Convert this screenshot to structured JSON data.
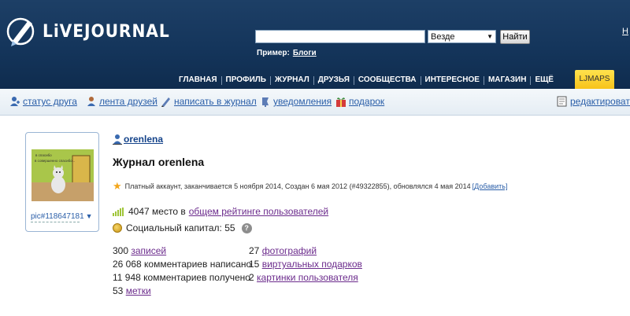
{
  "header": {
    "logo_text": "LiVEJOURNAL",
    "search": {
      "value": "",
      "scope": "Везде",
      "button": "Найти"
    },
    "example_label": "Пример:",
    "example_link": "Блоги",
    "top_right_link": "Н",
    "nav": [
      "ГЛАВНАЯ",
      "ПРОФИЛЬ",
      "ЖУРНАЛ",
      "ДРУЗЬЯ",
      "СООБЩЕСТВА",
      "ИНТЕРЕСНОЕ",
      "МАГАЗИН",
      "ЕЩЁ"
    ],
    "ljmaps": "LJMAPS"
  },
  "userbar": {
    "items": [
      {
        "label": "статус друга",
        "icon": "friend-status-icon"
      },
      {
        "label": "лента друзей",
        "icon": "friends-feed-icon"
      },
      {
        "label": "написать в журнал",
        "icon": "write-post-icon"
      },
      {
        "label": "уведомления",
        "icon": "notifications-icon"
      },
      {
        "label": "подарок",
        "icon": "gift-icon"
      },
      {
        "label": "редактировать",
        "icon": "edit-icon"
      }
    ]
  },
  "profile": {
    "userpic_label": "pic#118647181",
    "userpic_caption": "в спасибо\nв совершенно спасибо...",
    "username": "orenlena",
    "journal_title": "Журнал orenlena",
    "account_text": "Платный аккаунт, заканчивается 5 ноября 2014, Создан 6 мая 2012 (#49322855),  обновлялся 4 мая 2014",
    "account_link": "[Добавить]",
    "rating_place": "4047 место в",
    "rating_link": "общем рейтинге пользователей",
    "social_capital": "Социальный капитал: 55",
    "stats_left": [
      {
        "count": "300",
        "link": "записей",
        "text": ""
      },
      {
        "count": "",
        "link": "",
        "text": "26 068 комментариев написано"
      },
      {
        "count": "",
        "link": "",
        "text": "11 948 комментариев получено"
      },
      {
        "count": "53",
        "link": "метки",
        "text": ""
      }
    ],
    "stats_right": [
      {
        "count": "27",
        "link": "фотографий"
      },
      {
        "count": "15",
        "link": "виртуальных подарков"
      },
      {
        "count": "2",
        "link": "картинки пользователя"
      }
    ]
  },
  "colors": {
    "header_bg": "#14355b",
    "link": "#2a5ea8",
    "visited_link": "#6b2b8c",
    "ljmaps": "#f7c31a"
  }
}
